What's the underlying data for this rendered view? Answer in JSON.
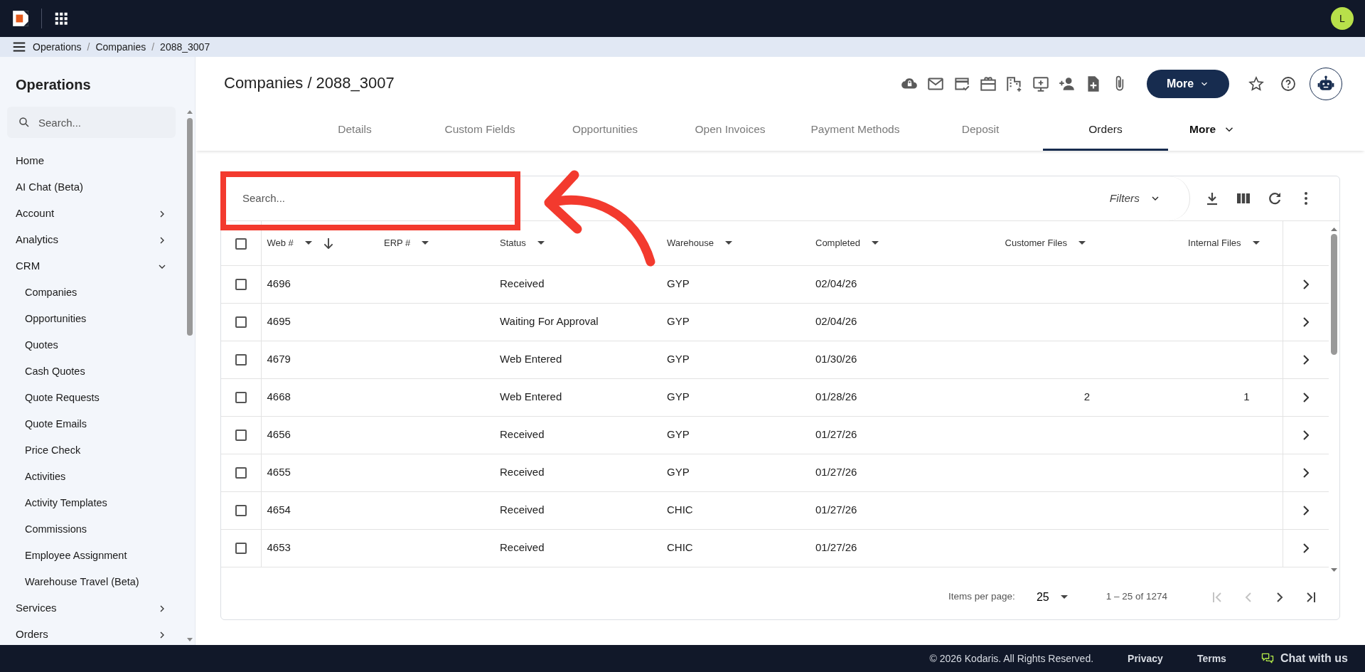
{
  "topbar": {
    "avatar": "L"
  },
  "breadcrumb": {
    "separator": "/",
    "items": [
      "Operations",
      "Companies",
      "2088_3007"
    ]
  },
  "sidebar": {
    "title": "Operations",
    "search": {
      "placeholder": "Search..."
    },
    "items": [
      {
        "label": "Home",
        "kind": "link"
      },
      {
        "label": "AI Chat (Beta)",
        "kind": "link"
      },
      {
        "label": "Account",
        "kind": "group",
        "expanded": false
      },
      {
        "label": "Analytics",
        "kind": "group",
        "expanded": false
      },
      {
        "label": "CRM",
        "kind": "group",
        "expanded": true,
        "children": [
          {
            "label": "Companies"
          },
          {
            "label": "Opportunities"
          },
          {
            "label": "Quotes"
          },
          {
            "label": "Cash Quotes"
          },
          {
            "label": "Quote Requests"
          },
          {
            "label": "Quote Emails"
          },
          {
            "label": "Price Check"
          },
          {
            "label": "Activities"
          },
          {
            "label": "Activity Templates"
          },
          {
            "label": "Commissions"
          },
          {
            "label": "Employee Assignment"
          },
          {
            "label": "Warehouse Travel (Beta)"
          }
        ]
      },
      {
        "label": "Services",
        "kind": "group",
        "expanded": false
      },
      {
        "label": "Orders",
        "kind": "group",
        "expanded": false
      }
    ]
  },
  "page": {
    "title": "Companies / 2088_3007",
    "more_button": "More"
  },
  "tabs": [
    {
      "label": "Details",
      "kind": "tab",
      "selected": false
    },
    {
      "label": "Custom Fields",
      "kind": "tab",
      "selected": false
    },
    {
      "label": "Opportunities",
      "kind": "tab",
      "selected": false
    },
    {
      "label": "Open Invoices",
      "kind": "tab",
      "selected": false
    },
    {
      "label": "Payment Methods",
      "kind": "tab",
      "selected": false
    },
    {
      "label": "Deposit",
      "kind": "tab",
      "selected": false
    },
    {
      "label": "Orders",
      "kind": "tab",
      "selected": true
    },
    {
      "label": "More",
      "kind": "menu",
      "selected": false
    }
  ],
  "table": {
    "search": {
      "placeholder": "Search..."
    },
    "filters": "Filters",
    "select_all": {
      "checked": false
    },
    "columns": [
      {
        "label": "Web #",
        "kind": "text",
        "sorted": true
      },
      {
        "label": "ERP #",
        "kind": "text",
        "sorted": false
      },
      {
        "label": "Status",
        "kind": "text",
        "sorted": false
      },
      {
        "label": "Warehouse",
        "kind": "text",
        "sorted": false
      },
      {
        "label": "Completed",
        "kind": "text",
        "sorted": false
      },
      {
        "label": "Customer Files",
        "kind": "count",
        "sorted": false
      },
      {
        "label": "Internal Files",
        "kind": "count",
        "sorted": false
      }
    ],
    "rows": [
      {
        "checked": false,
        "cells": [
          "4696",
          "",
          "Received",
          "GYP",
          "02/04/26",
          "",
          ""
        ]
      },
      {
        "checked": false,
        "cells": [
          "4695",
          "",
          "Waiting For Approval",
          "GYP",
          "02/04/26",
          "",
          ""
        ]
      },
      {
        "checked": false,
        "cells": [
          "4679",
          "",
          "Web Entered",
          "GYP",
          "01/30/26",
          "",
          ""
        ]
      },
      {
        "checked": false,
        "cells": [
          "4668",
          "",
          "Web Entered",
          "GYP",
          "01/28/26",
          "2",
          "1"
        ]
      },
      {
        "checked": false,
        "cells": [
          "4656",
          "",
          "Received",
          "GYP",
          "01/27/26",
          "",
          ""
        ]
      },
      {
        "checked": false,
        "cells": [
          "4655",
          "",
          "Received",
          "GYP",
          "01/27/26",
          "",
          ""
        ]
      },
      {
        "checked": false,
        "cells": [
          "4654",
          "",
          "Received",
          "CHIC",
          "01/27/26",
          "",
          ""
        ]
      },
      {
        "checked": false,
        "cells": [
          "4653",
          "",
          "Received",
          "CHIC",
          "01/27/26",
          "",
          ""
        ]
      }
    ],
    "pagination": {
      "label": "Items per page:",
      "page_size": "25",
      "range": "1 – 25 of 1274",
      "first_disabled": true,
      "previous_disabled": true,
      "next_disabled": false,
      "last_disabled": false
    }
  },
  "footer": {
    "copyright": "© 2026 Kodaris. All Rights Reserved.",
    "links": [
      "Privacy",
      "Terms"
    ],
    "chat": "Chat with us"
  }
}
